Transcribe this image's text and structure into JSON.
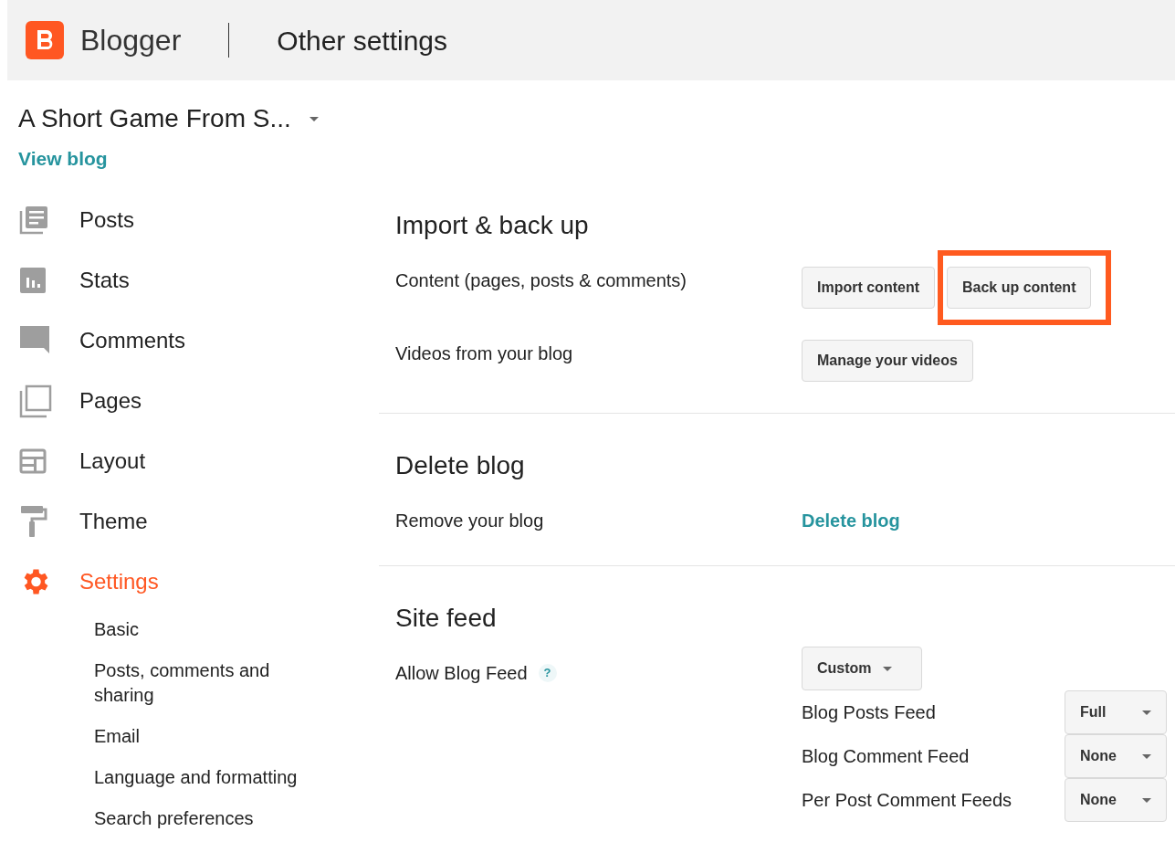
{
  "header": {
    "app_name": "Blogger",
    "page_title": "Other settings"
  },
  "sidebar": {
    "blog_name": "A Short Game From S...",
    "view_blog": "View blog",
    "items": [
      {
        "label": "Posts",
        "kind": "posts",
        "selected": false
      },
      {
        "label": "Stats",
        "kind": "stats",
        "selected": false
      },
      {
        "label": "Comments",
        "kind": "comments",
        "selected": false
      },
      {
        "label": "Pages",
        "kind": "pages",
        "selected": false
      },
      {
        "label": "Layout",
        "kind": "layout",
        "selected": false
      },
      {
        "label": "Theme",
        "kind": "theme",
        "selected": false
      },
      {
        "label": "Settings",
        "kind": "settings",
        "selected": true,
        "children": [
          {
            "label": "Basic"
          },
          {
            "label": "Posts, comments and sharing"
          },
          {
            "label": "Email"
          },
          {
            "label": "Language and formatting"
          },
          {
            "label": "Search preferences"
          }
        ]
      }
    ]
  },
  "sections": [
    {
      "title": "Import & back up",
      "rows": [
        {
          "label": "Content (pages, posts & comments)",
          "kind": "buttons",
          "buttons": [
            {
              "label": "Import content",
              "highlighted": false
            },
            {
              "label": "Back up content",
              "highlighted": true
            }
          ]
        },
        {
          "label": "Videos from your blog",
          "kind": "buttons",
          "buttons": [
            {
              "label": "Manage your videos",
              "highlighted": false
            }
          ]
        }
      ]
    },
    {
      "title": "Delete blog",
      "rows": [
        {
          "label": "Remove your blog",
          "kind": "link",
          "link": "Delete blog"
        }
      ]
    },
    {
      "title": "Site feed",
      "rows": [
        {
          "label": "Allow Blog Feed",
          "kind": "feed",
          "help": "?",
          "value": "Custom",
          "feeds": [
            {
              "label": "Blog Posts Feed",
              "value": "Full"
            },
            {
              "label": "Blog Comment Feed",
              "value": "None"
            },
            {
              "label": "Per Post Comment Feeds",
              "value": "None"
            }
          ]
        }
      ]
    }
  ]
}
